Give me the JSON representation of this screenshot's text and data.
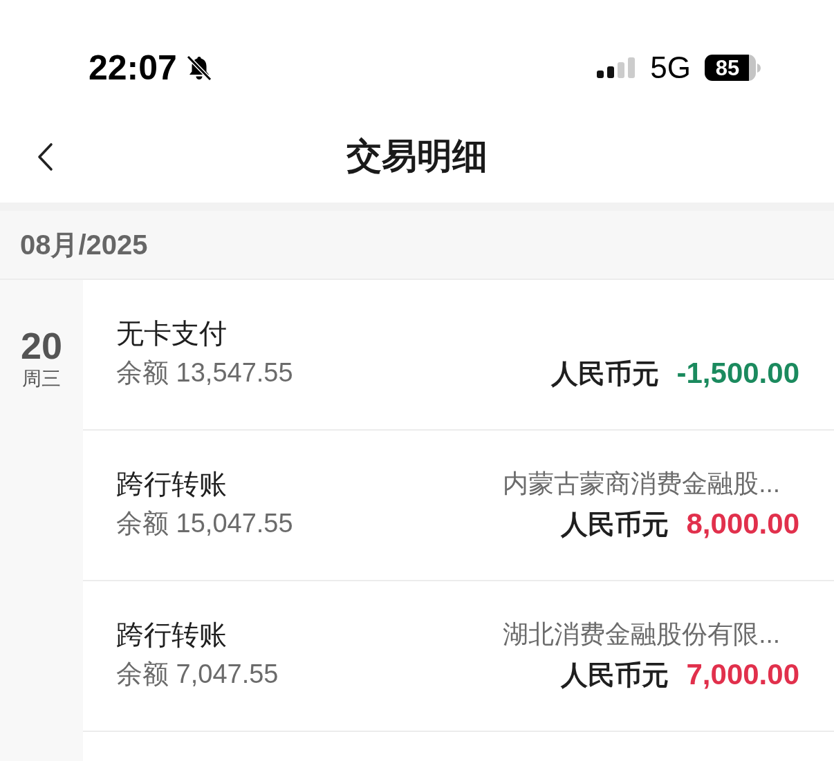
{
  "status_bar": {
    "time": "22:07",
    "network": "5G",
    "battery": "85"
  },
  "nav": {
    "title": "交易明细"
  },
  "month": "08月/2025",
  "days": [
    {
      "day": "20",
      "weekday": "周三",
      "transactions": [
        {
          "title": "无卡支付",
          "balance": "余额 13,547.55",
          "currency": "人民币元",
          "amount": "-1,500.00",
          "kind": "debit"
        },
        {
          "title": "跨行转账",
          "balance": "余额 15,047.55",
          "counterparty": "内蒙古蒙商消费金融股...",
          "currency": "人民币元",
          "amount": "8,000.00",
          "kind": "credit"
        },
        {
          "title": "跨行转账",
          "balance": "余额 7,047.55",
          "counterparty": "湖北消费金融股份有限...",
          "currency": "人民币元",
          "amount": "7,000.00",
          "kind": "credit"
        }
      ]
    }
  ]
}
